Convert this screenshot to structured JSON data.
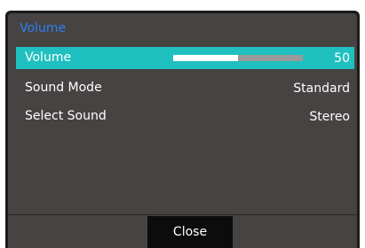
{
  "menu": {
    "title": "Volume",
    "items": [
      {
        "label": "Volume",
        "value": "50",
        "level": 0.5,
        "selected": true
      },
      {
        "label": "Sound Mode",
        "value": "Standard",
        "selected": false
      },
      {
        "label": "Select Sound",
        "value": "Stereo",
        "selected": false
      }
    ]
  },
  "footer": {
    "close_label": "Close"
  },
  "colors": {
    "title": "#2f7ff0",
    "highlight": "#21c0c0",
    "panel": "#474342",
    "frame": "#1b1b1b",
    "slider_track": "#9a9a9a",
    "slider_fill": "#ffffff"
  }
}
